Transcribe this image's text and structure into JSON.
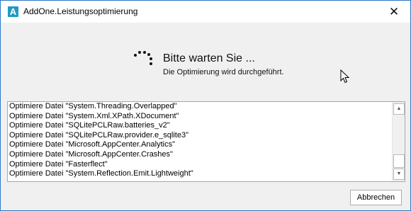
{
  "window": {
    "title": "AddOne.Leistungsoptimierung",
    "app_icon_letter": "A",
    "close_glyph": "✕"
  },
  "status": {
    "heading": "Bitte warten Sie ...",
    "subtext": "Die Optimierung wird durchgeführt."
  },
  "log": {
    "lines": [
      "Optimiere Datei \"System.Threading.Overlapped\"",
      "Optimiere Datei \"System.Xml.XPath.XDocument\"",
      "Optimiere Datei \"SQLitePCLRaw.batteries_v2\"",
      "Optimiere Datei \"SQLitePCLRaw.provider.e_sqlite3\"",
      "Optimiere Datei \"Microsoft.AppCenter.Analytics\"",
      "Optimiere Datei \"Microsoft.AppCenter.Crashes\"",
      "Optimiere Datei \"Fasterflect\"",
      "Optimiere Datei \"System.Reflection.Emit.Lightweight\""
    ],
    "scroll_up_glyph": "▲",
    "scroll_down_glyph": "▼"
  },
  "buttons": {
    "cancel_label": "Abbrechen"
  },
  "icons": {
    "app": "app-logo-icon",
    "close": "close-icon",
    "spinner": "loading-spinner-icon",
    "cursor": "mouse-pointer-icon"
  },
  "colors": {
    "window_border": "#2b78c5",
    "app_icon": "#1f9bc4",
    "dialog_background": "#f0f0f0"
  }
}
